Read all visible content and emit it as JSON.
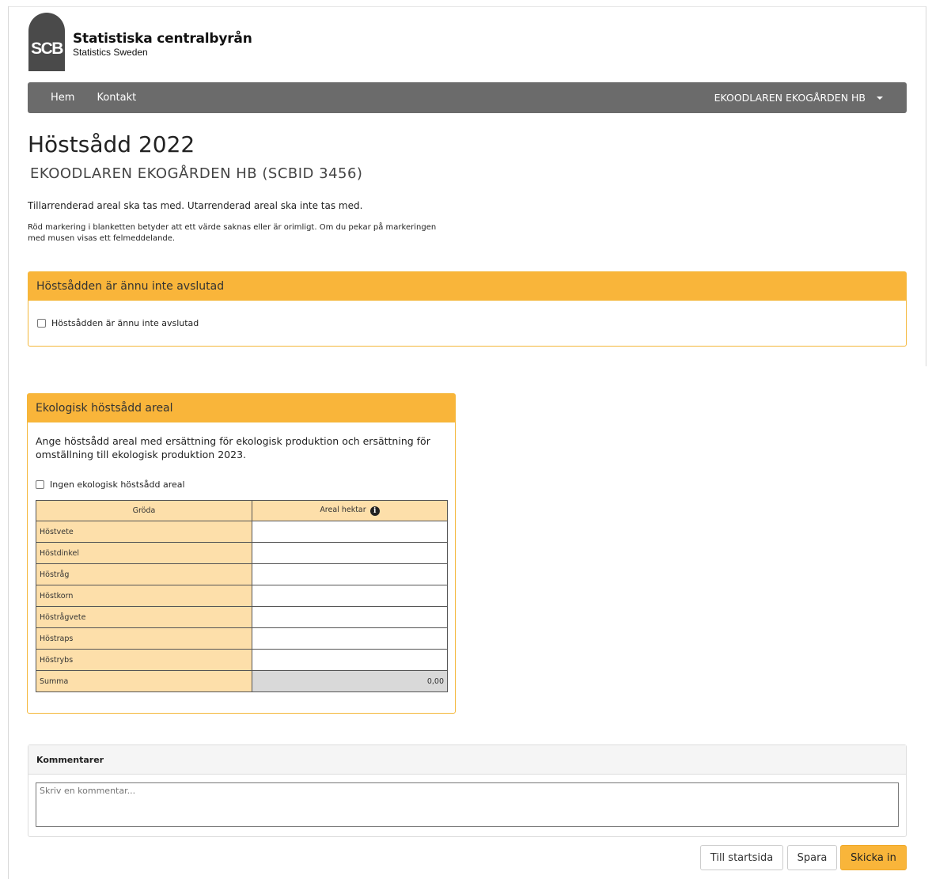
{
  "brand": {
    "logo_letters": "SCB",
    "name": "Statistiska centralbyrån",
    "sub": "Statistics Sweden"
  },
  "nav": {
    "home": "Hem",
    "contact": "Kontakt",
    "user": "EKOODLAREN EKOGÅRDEN HB"
  },
  "page": {
    "title": "Höstsådd 2022",
    "subtitle": "EKOODLAREN EKOGÅRDEN HB (SCBID 3456)",
    "info1": "Tillarrenderad areal ska tas med. Utarrenderad areal ska inte tas med.",
    "info2": "Röd markering i blanketten betyder att ett värde saknas eller är orimligt. Om du pekar på markeringen med musen visas ett felmeddelande."
  },
  "panel_not_finished": {
    "heading": "Höstsådden är ännu inte avslutad",
    "checkbox_label": "Höstsådden är ännu inte avslutad"
  },
  "panel_eco": {
    "heading": "Ekologisk höstsådd areal",
    "description": "Ange höstsådd areal med ersättning för ekologisk produktion och ersättning för omställning till ekologisk produktion 2023.",
    "checkbox_label": "Ingen ekologisk höstsådd areal",
    "table": {
      "col_crop": "Gröda",
      "col_area": "Areal hektar",
      "rows": [
        "Höstvete",
        "Höstdinkel",
        "Höstråg",
        "Höstkorn",
        "Höstrågvete",
        "Höstraps",
        "Höstrybs"
      ],
      "sum_label": "Summa",
      "sum_value": "0,00"
    }
  },
  "comments": {
    "heading": "Kommentarer",
    "placeholder": "Skriv en kommentar..."
  },
  "buttons": {
    "home": "Till startsida",
    "save": "Spara",
    "submit": "Skicka in"
  },
  "colors": {
    "accent": "#f9b53a",
    "navbar": "#6b6b6b",
    "table_label_bg": "#fddfaa"
  }
}
